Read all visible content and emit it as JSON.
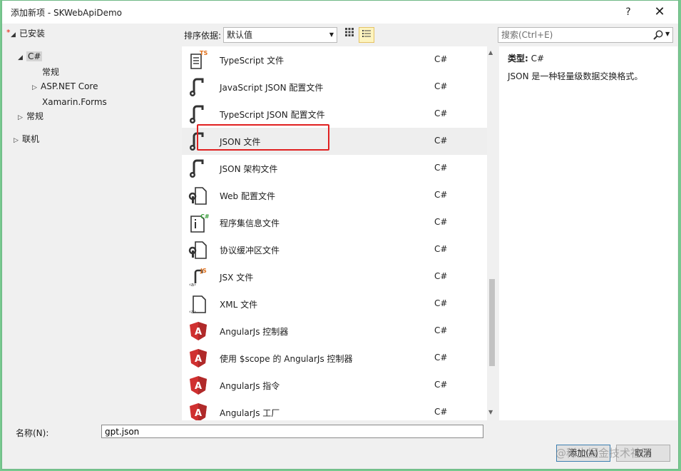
{
  "title": "添加新项 - SKWebApiDemo",
  "titlebar": {
    "help": "?",
    "close": "✕"
  },
  "tree": {
    "installed": "已安装",
    "csharp": "C#",
    "general": "常规",
    "aspnet": "ASP.NET Core",
    "xamarin": "Xamarin.Forms",
    "general2": "常规",
    "online": "联机"
  },
  "toolbar": {
    "sort_label": "排序依据:",
    "sort_value": "默认值"
  },
  "search": {
    "placeholder": "搜索(Ctrl+E)"
  },
  "items": [
    {
      "name": "TypeScript 文件",
      "lang": "C#",
      "icon": "typescript-file-icon"
    },
    {
      "name": "JavaScript JSON 配置文件",
      "lang": "C#",
      "icon": "json-config-icon"
    },
    {
      "name": "TypeScript JSON 配置文件",
      "lang": "C#",
      "icon": "json-config-icon"
    },
    {
      "name": "JSON 文件",
      "lang": "C#",
      "icon": "json-file-icon"
    },
    {
      "name": "JSON 架构文件",
      "lang": "C#",
      "icon": "json-schema-icon"
    },
    {
      "name": "Web 配置文件",
      "lang": "C#",
      "icon": "web-config-icon"
    },
    {
      "name": "程序集信息文件",
      "lang": "C#",
      "icon": "assembly-info-icon"
    },
    {
      "name": "协议缓冲区文件",
      "lang": "C#",
      "icon": "protobuf-file-icon"
    },
    {
      "name": "JSX 文件",
      "lang": "C#",
      "icon": "jsx-file-icon"
    },
    {
      "name": "XML 文件",
      "lang": "C#",
      "icon": "xml-file-icon"
    },
    {
      "name": "AngularJs 控制器",
      "lang": "C#",
      "icon": "angular-icon"
    },
    {
      "name": "使用 $scope 的 AngularJs 控制器",
      "lang": "C#",
      "icon": "angular-icon"
    },
    {
      "name": "AngularJs 指令",
      "lang": "C#",
      "icon": "angular-icon"
    },
    {
      "name": "AngularJs 工厂",
      "lang": "C#",
      "icon": "angular-icon"
    }
  ],
  "details": {
    "type_label": "类型:",
    "type_value": "C#",
    "description": "JSON 是一种轻量级数据交换格式。"
  },
  "bottom": {
    "name_label": "名称(N):",
    "name_value": "gpt.json",
    "add_label": "添加(A)",
    "cancel_label": "取消"
  },
  "watermark": "@稀土掘金技术社区",
  "colors": {
    "highlight": "#e02020",
    "angular": "#d03030",
    "accent": "#3c7fb1"
  }
}
